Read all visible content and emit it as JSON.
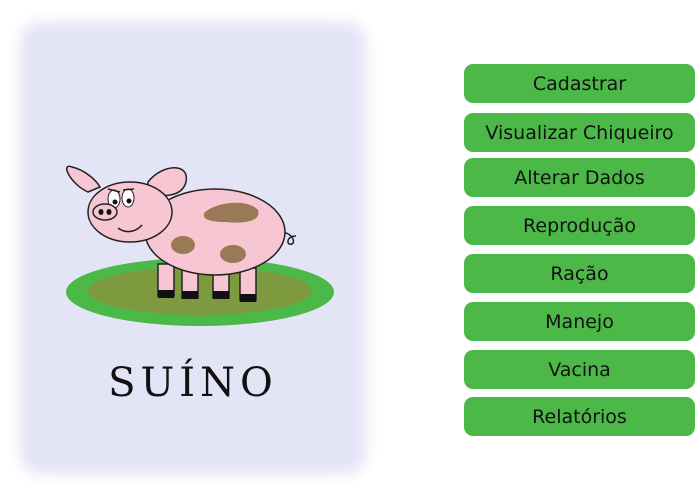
{
  "card": {
    "title": "SUÍNO"
  },
  "menu": {
    "items": [
      {
        "label": "Cadastrar",
        "name": "cadastrar-button"
      },
      {
        "label": "Visualizar Chiqueiro",
        "name": "visualizar-chiqueiro-button"
      },
      {
        "label": "Alterar Dados",
        "name": "alterar-dados-button"
      },
      {
        "label": "Reprodução",
        "name": "reproducao-button"
      },
      {
        "label": "Ração",
        "name": "racao-button"
      },
      {
        "label": "Manejo",
        "name": "manejo-button"
      },
      {
        "label": "Vacina",
        "name": "vacina-button"
      },
      {
        "label": "Relatórios",
        "name": "relatorios-button"
      }
    ]
  },
  "colors": {
    "button_green": "#4cb848",
    "panel_lavender": "#e4e4f7",
    "pig_pink": "#f7c6d3",
    "grass_green": "#4cb848",
    "grass_olive": "#7e9a3f"
  }
}
